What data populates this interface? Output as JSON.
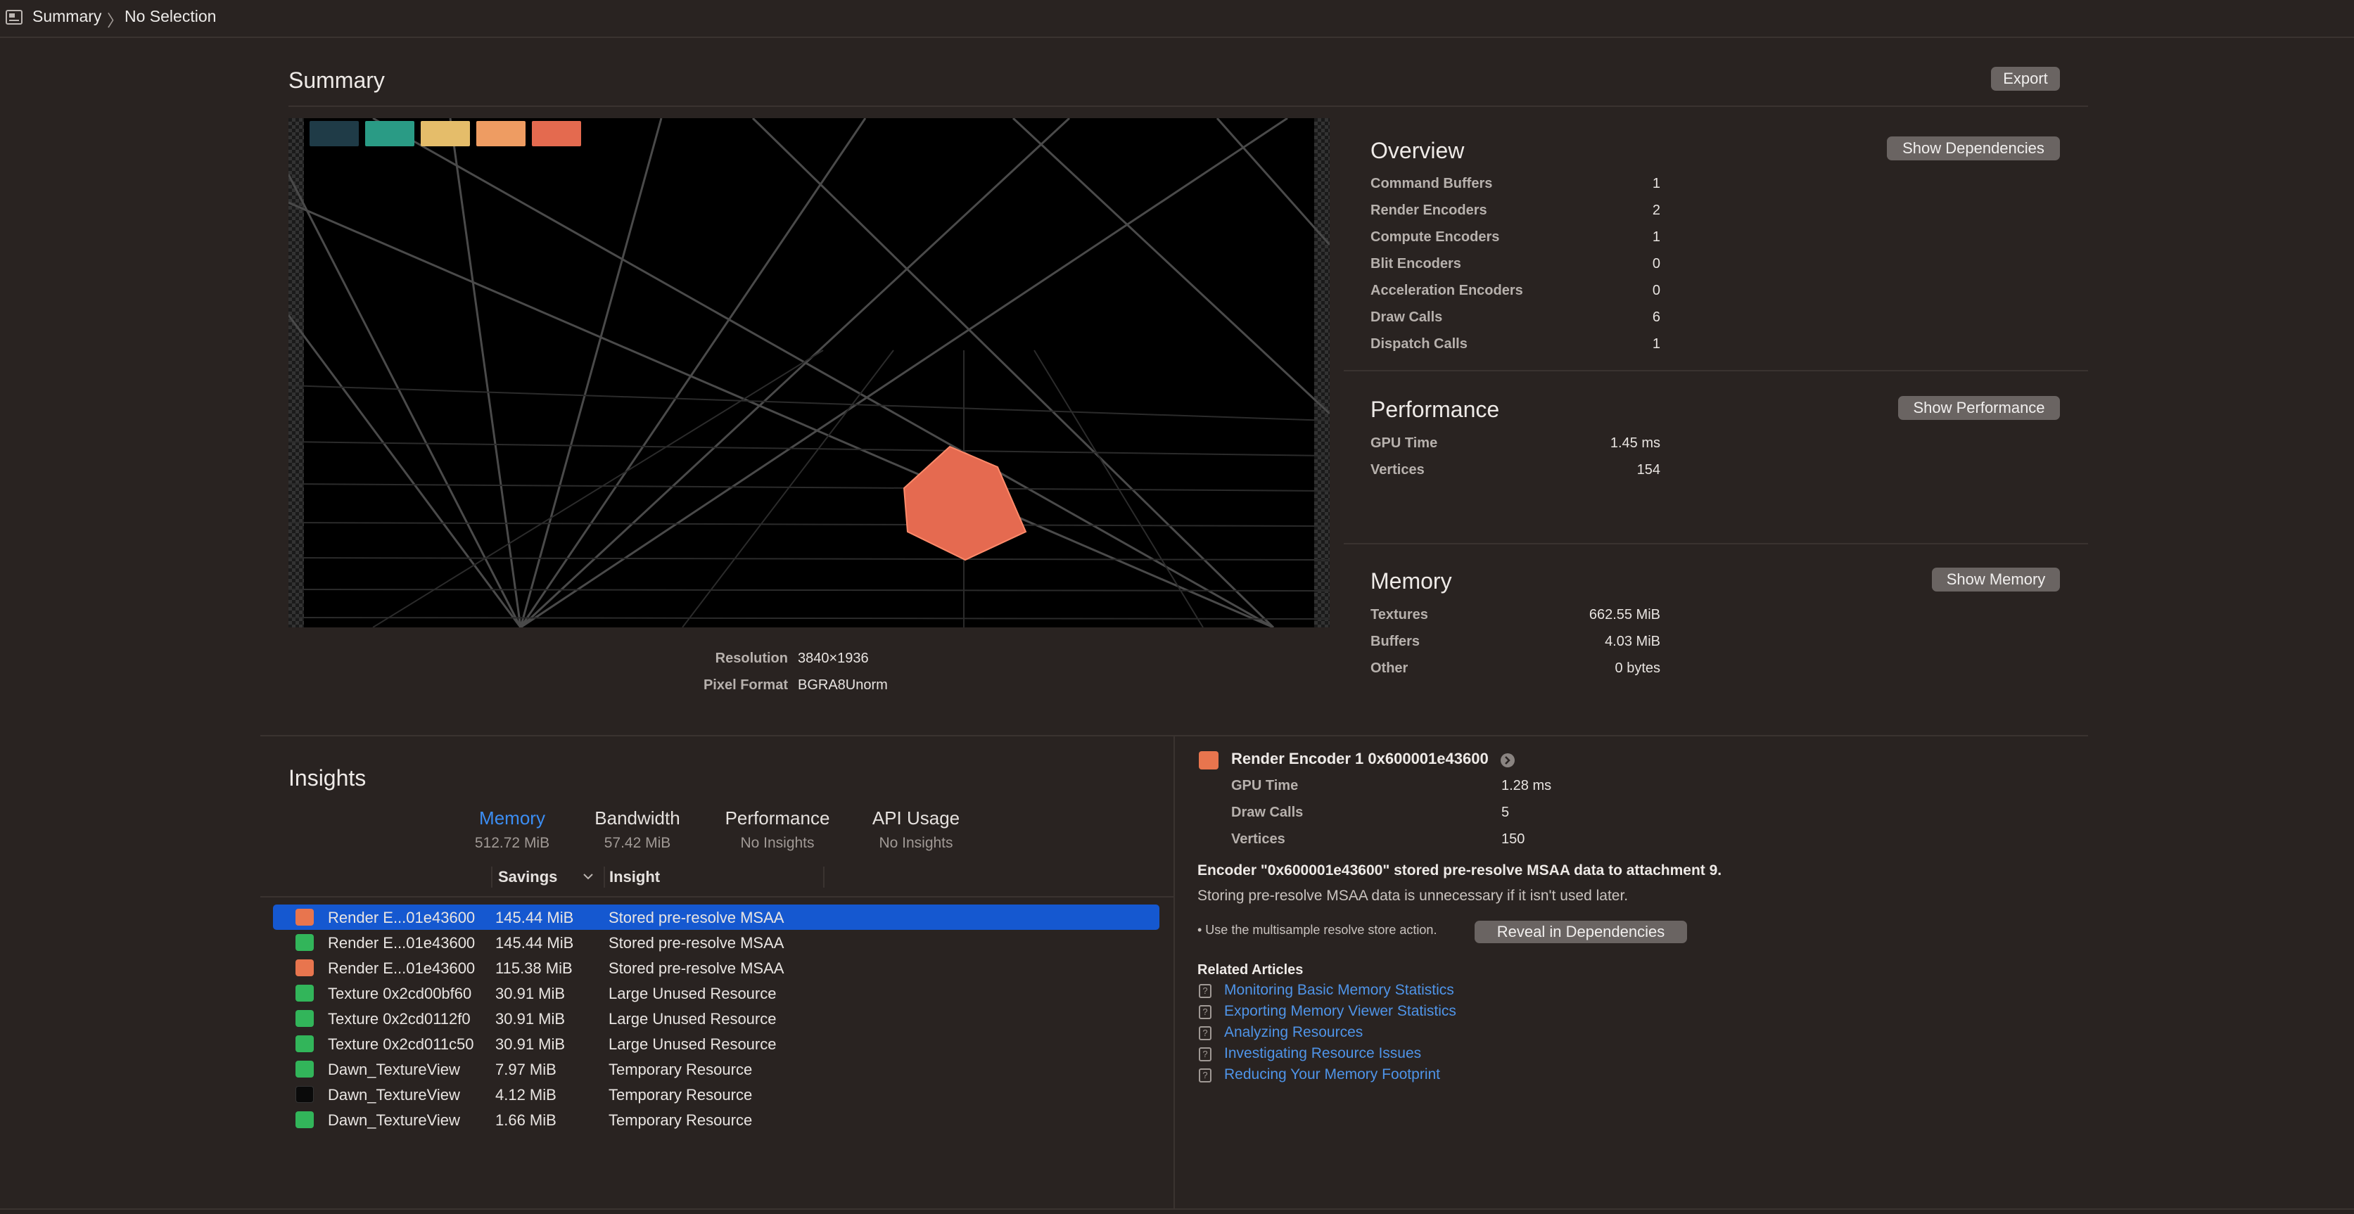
{
  "breadcrumb": {
    "first": "Summary",
    "separator": "〉",
    "second": "No Selection"
  },
  "summary": {
    "title": "Summary",
    "export_label": "Export"
  },
  "preview": {
    "swatches": [
      "#1f3b47",
      "#2a9b85",
      "#e5bd6a",
      "#ee9c62",
      "#e46a4f"
    ],
    "shape_color": "#e56a50"
  },
  "image_meta": {
    "resolution_label": "Resolution",
    "resolution_value": "3840×1936",
    "format_label": "Pixel Format",
    "format_value": "BGRA8Unorm"
  },
  "overview": {
    "title": "Overview",
    "button": "Show Dependencies",
    "rows": [
      {
        "label": "Command Buffers",
        "value": "1"
      },
      {
        "label": "Render Encoders",
        "value": "2"
      },
      {
        "label": "Compute Encoders",
        "value": "1"
      },
      {
        "label": "Blit Encoders",
        "value": "0"
      },
      {
        "label": "Acceleration Encoders",
        "value": "0"
      },
      {
        "label": "Draw Calls",
        "value": "6"
      },
      {
        "label": "Dispatch Calls",
        "value": "1"
      }
    ]
  },
  "performance": {
    "title": "Performance",
    "button": "Show Performance",
    "rows": [
      {
        "label": "GPU Time",
        "value": "1.45 ms"
      },
      {
        "label": "Vertices",
        "value": "154"
      }
    ]
  },
  "memory": {
    "title": "Memory",
    "button": "Show Memory",
    "rows": [
      {
        "label": "Textures",
        "value": "662.55 MiB"
      },
      {
        "label": "Buffers",
        "value": "4.03 MiB"
      },
      {
        "label": "Other",
        "value": "0 bytes"
      }
    ]
  },
  "insights": {
    "title": "Insights",
    "tabs": [
      {
        "name": "Memory",
        "sub": "512.72 MiB"
      },
      {
        "name": "Bandwidth",
        "sub": "57.42 MiB"
      },
      {
        "name": "Performance",
        "sub": "No Insights"
      },
      {
        "name": "API Usage",
        "sub": "No Insights"
      }
    ],
    "columns": {
      "savings": "Savings",
      "insight": "Insight"
    },
    "rows": [
      {
        "name": "Render E...01e43600",
        "savings": "145.44 MiB",
        "insight": "Stored pre-resolve MSAA",
        "icon": "render-encoder-icon"
      },
      {
        "name": "Render E...01e43600",
        "savings": "145.44 MiB",
        "insight": "Stored pre-resolve MSAA",
        "icon": "texture-icon"
      },
      {
        "name": "Render E...01e43600",
        "savings": "115.38 MiB",
        "insight": "Stored pre-resolve MSAA",
        "icon": "render-encoder-icon"
      },
      {
        "name": "Texture 0x2cd00bf60",
        "savings": "30.91 MiB",
        "insight": "Large Unused Resource",
        "icon": "texture-icon"
      },
      {
        "name": "Texture 0x2cd0112f0",
        "savings": "30.91 MiB",
        "insight": "Large Unused Resource",
        "icon": "texture-icon"
      },
      {
        "name": "Texture 0x2cd011c50",
        "savings": "30.91 MiB",
        "insight": "Large Unused Resource",
        "icon": "texture-icon"
      },
      {
        "name": "Dawn_TextureView",
        "savings": "7.97 MiB",
        "insight": "Temporary Resource",
        "icon": "texture-icon"
      },
      {
        "name": "Dawn_TextureView",
        "savings": "4.12 MiB",
        "insight": "Temporary Resource",
        "icon": "dark-texture-icon"
      },
      {
        "name": "Dawn_TextureView",
        "savings": "1.66 MiB",
        "insight": "Temporary Resource",
        "icon": "texture-icon"
      }
    ]
  },
  "detail": {
    "encoder_title": "Render Encoder 1 0x600001e43600",
    "stats": [
      {
        "label": "GPU Time",
        "value": "1.28 ms"
      },
      {
        "label": "Draw Calls",
        "value": "5"
      },
      {
        "label": "Vertices",
        "value": "150"
      }
    ],
    "headline": "Encoder \"0x600001e43600\" stored pre-resolve MSAA data to attachment 9.",
    "explanation": "Storing pre-resolve MSAA data is unnecessary if it isn't used later.",
    "bullet": "• Use the multisample resolve store action.",
    "reveal_button": "Reveal in Dependencies",
    "related_title": "Related Articles",
    "articles": [
      "Monitoring Basic Memory Statistics",
      "Exporting Memory Viewer Statistics",
      "Analyzing Resources",
      "Investigating Resource Issues",
      "Reducing Your Memory Footprint"
    ]
  }
}
